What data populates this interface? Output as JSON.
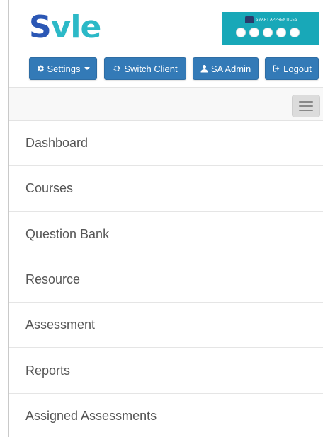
{
  "header": {
    "logo": {
      "s": "S",
      "vle": "vle"
    },
    "partner_logo": {
      "title": "SMART APPRENTICES"
    },
    "buttons": {
      "settings": "Settings",
      "switch_client": "Switch Client",
      "admin": "SA Admin",
      "logout": "Logout"
    },
    "button_color": "#337ab7"
  },
  "menu": {
    "items": [
      {
        "label": "Dashboard"
      },
      {
        "label": "Courses"
      },
      {
        "label": "Question Bank"
      },
      {
        "label": "Resource"
      },
      {
        "label": "Assessment"
      },
      {
        "label": "Reports"
      },
      {
        "label": "Assigned Assessments"
      }
    ]
  },
  "icons": [
    "gear-icon",
    "refresh-icon",
    "user-icon",
    "sign-out-icon",
    "hamburger-icon"
  ]
}
